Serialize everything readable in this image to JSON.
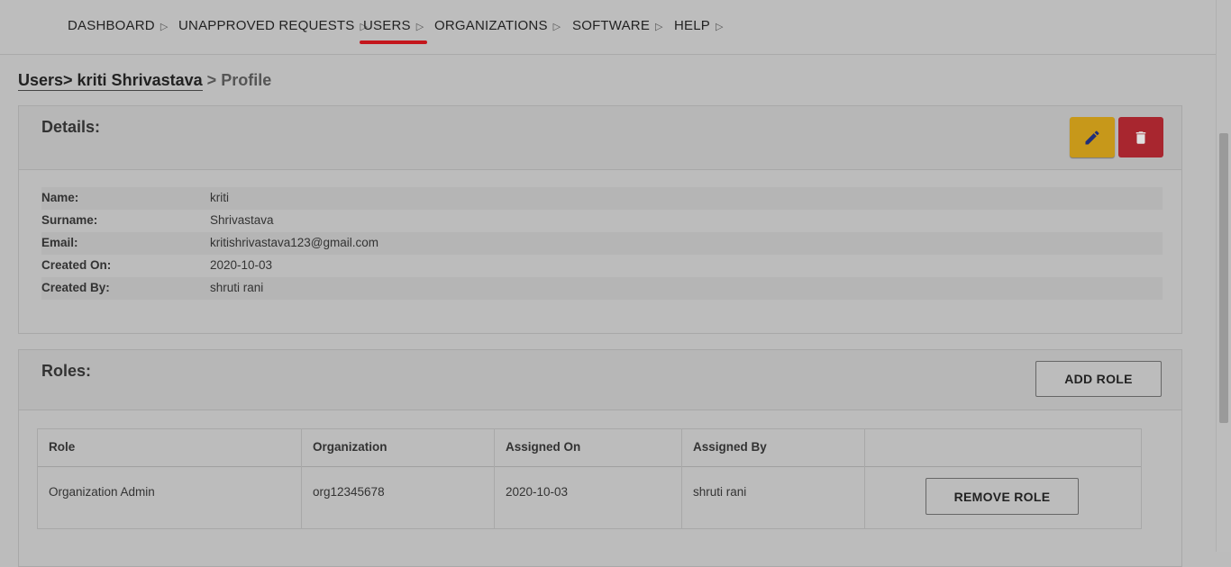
{
  "nav": {
    "items": [
      {
        "label": "DASHBOARD",
        "active": false
      },
      {
        "label": "UNAPPROVED REQUESTS",
        "active": false
      },
      {
        "label": "USERS",
        "active": true
      },
      {
        "label": "ORGANIZATIONS",
        "active": false
      },
      {
        "label": "SOFTWARE",
        "active": false
      },
      {
        "label": "HELP",
        "active": false
      }
    ],
    "arrow": "▷",
    "active_color": "#c4161c"
  },
  "breadcrumb": {
    "link": "Users> kriti Shrivastava",
    "separator": ">",
    "current": "Profile"
  },
  "details": {
    "title": "Details:",
    "edit_icon": "pencil-icon",
    "delete_icon": "trash-icon",
    "rows": [
      {
        "label": "Name:",
        "value": "kriti"
      },
      {
        "label": "Surname:",
        "value": "Shrivastava"
      },
      {
        "label": "Email:",
        "value": "kritishrivastava123@gmail.com"
      },
      {
        "label": "Created On:",
        "value": "2020-10-03"
      },
      {
        "label": "Created By:",
        "value": "shruti rani"
      }
    ]
  },
  "roles": {
    "title": "Roles:",
    "add_label": "ADD ROLE",
    "columns": [
      "Role",
      "Organization",
      "Assigned On",
      "Assigned By",
      ""
    ],
    "rows": [
      {
        "role": "Organization Admin",
        "organization": "org12345678",
        "assigned_on": "2020-10-03",
        "assigned_by": "shruti rani",
        "action_label": "REMOVE ROLE"
      }
    ]
  },
  "colors": {
    "edit_button": "#c7981a",
    "delete_button": "#a8262f",
    "accent": "#c4161c"
  }
}
